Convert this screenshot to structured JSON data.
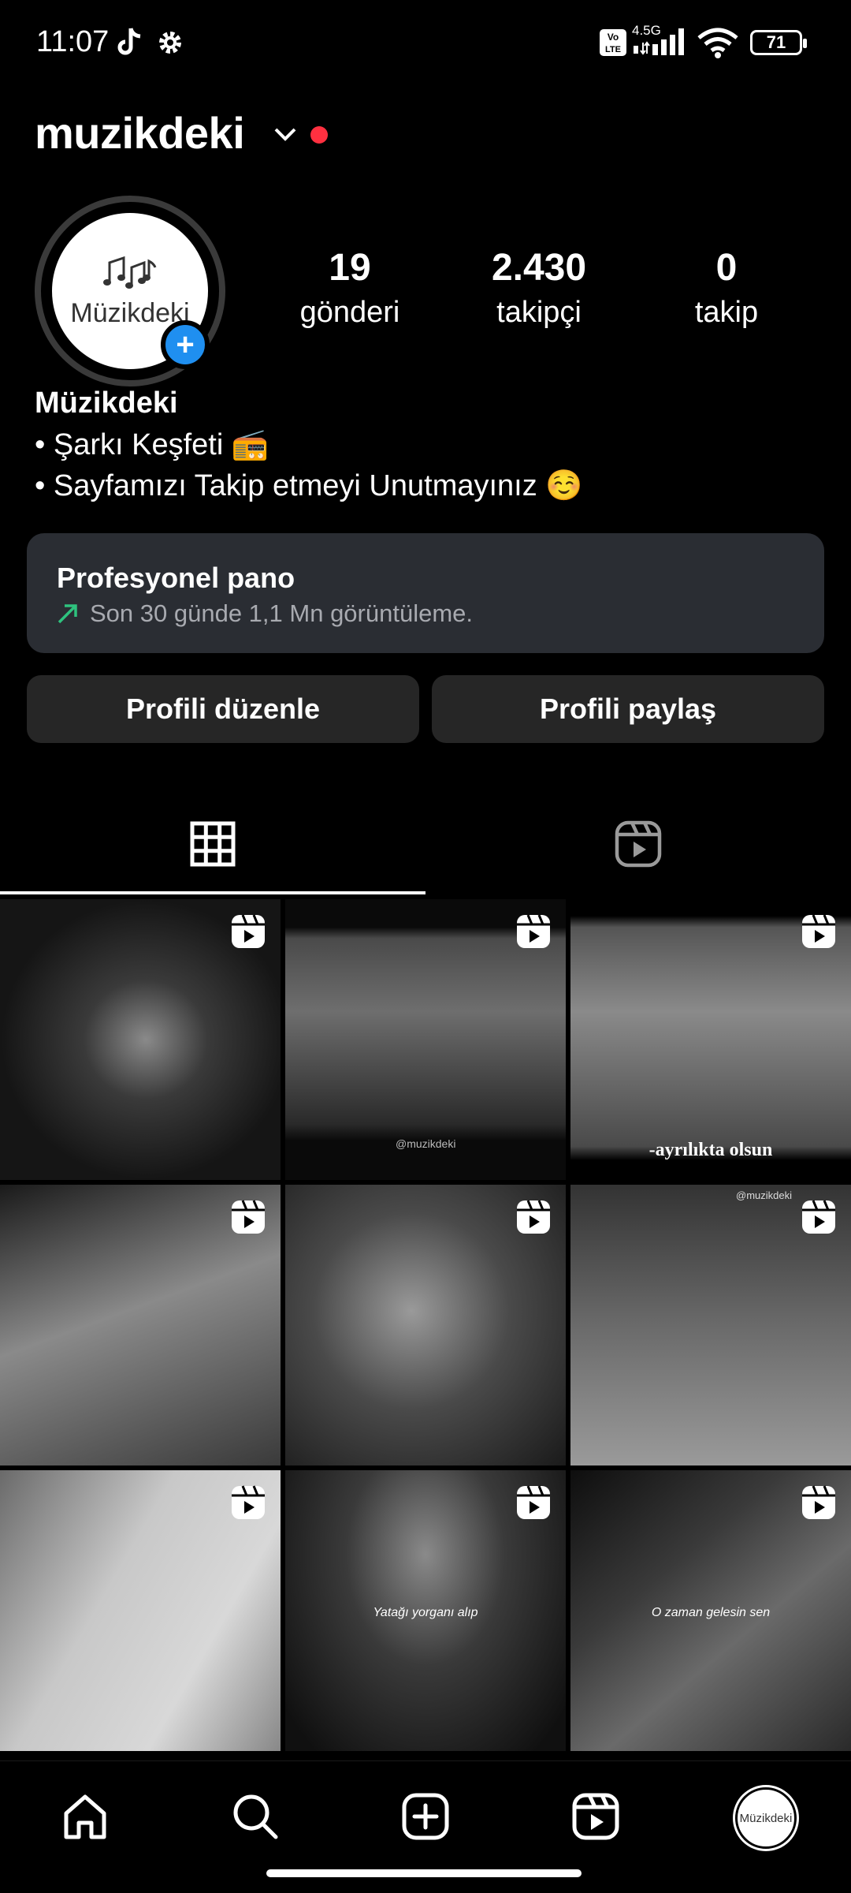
{
  "status_bar": {
    "time": "11:07",
    "network": "4.5G",
    "battery": "71",
    "icons": [
      "tiktok-icon",
      "settings-icon",
      "volte-icon",
      "signal-icon",
      "wifi-icon",
      "battery-icon"
    ]
  },
  "header": {
    "username": "muzikdeki",
    "has_notification_dot": true
  },
  "profile": {
    "avatar_text": "Müzikdeki",
    "stats": [
      {
        "value": "19",
        "label": "gönderi"
      },
      {
        "value": "2.430",
        "label": "takipçi"
      },
      {
        "value": "0",
        "label": "takip"
      }
    ],
    "display_name": "Müzikdeki",
    "bio_lines": [
      "• Şarkı Keşfeti 📻",
      "• Sayfamızı Takip etmeyi Unutmayınız ☺️"
    ]
  },
  "dashboard": {
    "title": "Profesyonel pano",
    "subtitle": "Son 30 günde 1,1 Mn görüntüleme."
  },
  "buttons": {
    "edit": "Profili düzenle",
    "share": "Profili paylaş"
  },
  "tabs": [
    {
      "name": "grid",
      "icon": "grid-icon",
      "active": true
    },
    {
      "name": "reels",
      "icon": "reels-icon",
      "active": false
    }
  ],
  "posts": [
    {
      "type": "reel",
      "caption": ""
    },
    {
      "type": "reel",
      "caption": "@muzikdeki"
    },
    {
      "type": "reel",
      "caption": "-ayrılıkta olsun"
    },
    {
      "type": "reel",
      "caption": ""
    },
    {
      "type": "reel",
      "caption": ""
    },
    {
      "type": "reel",
      "caption": "@muzikdeki"
    },
    {
      "type": "reel",
      "caption": ""
    },
    {
      "type": "reel",
      "caption": "Yatağı yorganı alıp"
    },
    {
      "type": "reel",
      "caption": "O zaman gelesin sen"
    }
  ],
  "bottom_nav": {
    "avatar_text": "Müzikdeki",
    "items": [
      "home-icon",
      "search-icon",
      "create-icon",
      "reels-icon",
      "profile-avatar"
    ]
  },
  "colors": {
    "background": "#000000",
    "card": "#2a2d33",
    "button": "#262626",
    "accent_blue": "#1f8ff0",
    "notification_red": "#ff3040",
    "trend_green": "#2ec27e"
  }
}
